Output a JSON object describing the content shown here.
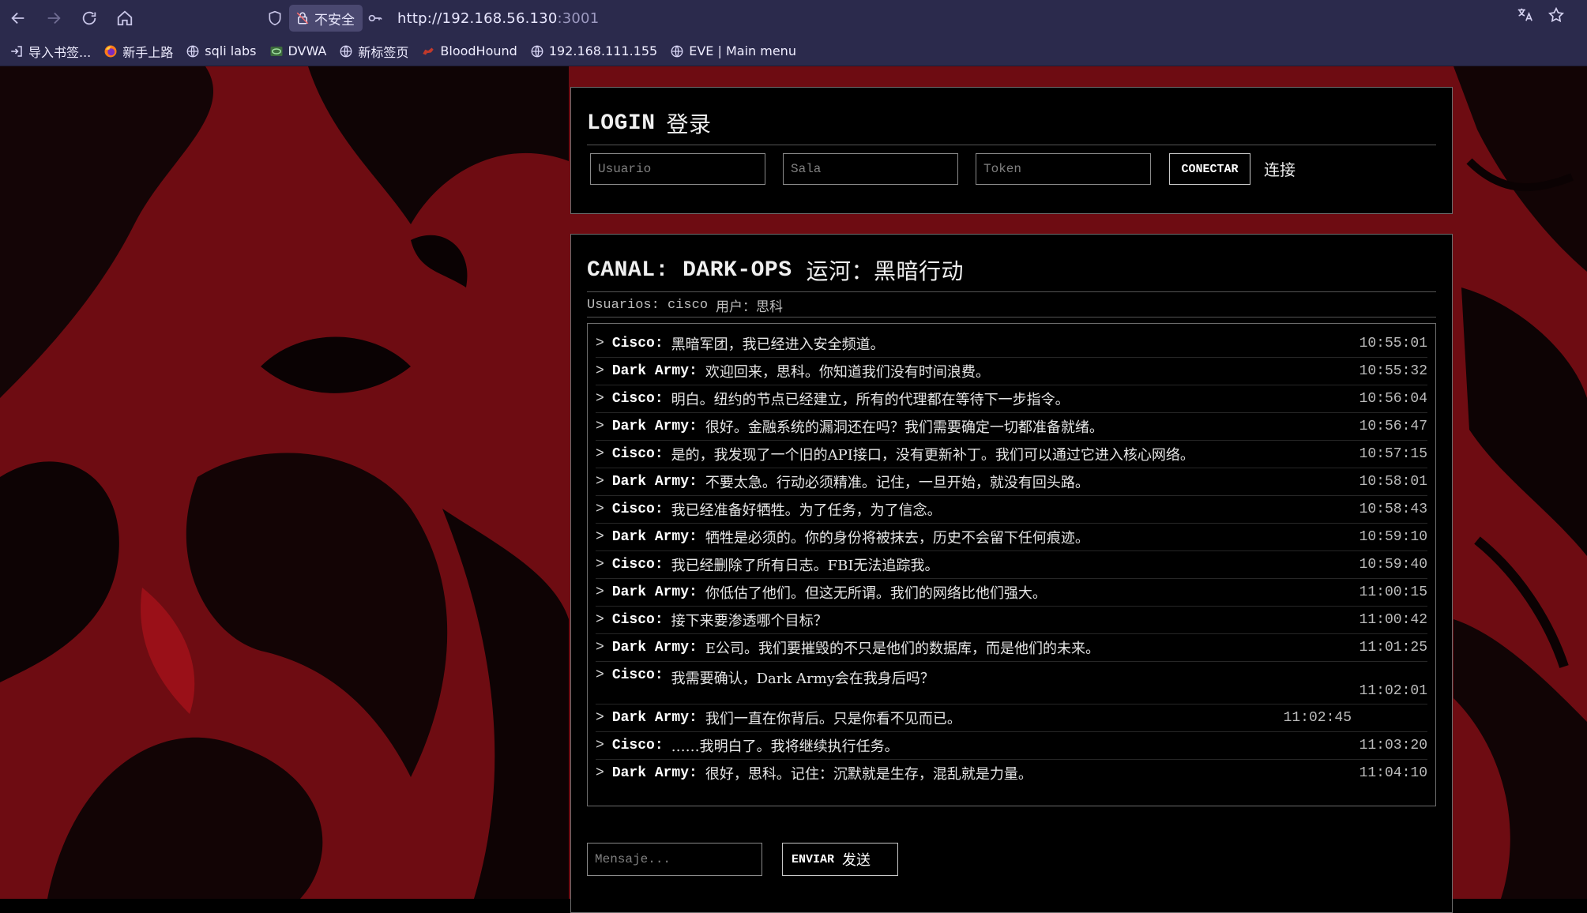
{
  "browser": {
    "security_label": "不安全",
    "url_host": "http://192.168.56.130",
    "url_port": ":3001",
    "bookmarks": [
      {
        "label": "导入书签...",
        "icon": "import-icon"
      },
      {
        "label": "新手上路",
        "icon": "firefox-icon"
      },
      {
        "label": "sqli labs",
        "icon": "globe-icon"
      },
      {
        "label": "DVWA",
        "icon": "dvwa-icon"
      },
      {
        "label": "新标签页",
        "icon": "globe-icon"
      },
      {
        "label": "BloodHound",
        "icon": "bloodhound-icon"
      },
      {
        "label": "192.168.111.155",
        "icon": "globe-icon"
      },
      {
        "label": "EVE | Main menu",
        "icon": "globe-icon"
      }
    ]
  },
  "login": {
    "title": "LOGIN",
    "title_cn": "登录",
    "user_placeholder": "Usuario",
    "room_placeholder": "Sala",
    "token_placeholder": "Token",
    "connect_label": "CONECTAR",
    "connect_cn": "连接"
  },
  "chat": {
    "title": "CANAL: DARK-OPS",
    "title_cn": "运河：黑暗行动",
    "users_label": "Usuarios: cisco",
    "users_cn": "用户：思科",
    "prompt": ">",
    "messages": [
      {
        "author": "Cisco:",
        "text": "黑暗军团，我已经进入安全频道。",
        "time": "10:55:01"
      },
      {
        "author": "Dark Army:",
        "text": "欢迎回来，思科。你知道我们没有时间浪费。",
        "time": "10:55:32"
      },
      {
        "author": "Cisco:",
        "text": "明白。纽约的节点已经建立，所有的代理都在等待下一步指令。",
        "time": "10:56:04"
      },
      {
        "author": "Dark Army:",
        "text": "很好。金融系统的漏洞还在吗？我们需要确定一切都准备就绪。",
        "time": "10:56:47"
      },
      {
        "author": "Cisco:",
        "text": "是的，我发现了一个旧的API接口，没有更新补丁。我们可以通过它进入核心网络。",
        "time": "10:57:15"
      },
      {
        "author": "Dark Army:",
        "text": "不要太急。行动必须精准。记住，一旦开始，就没有回头路。",
        "time": "10:58:01"
      },
      {
        "author": "Cisco:",
        "text": "我已经准备好牺牲。为了任务，为了信念。",
        "time": "10:58:43"
      },
      {
        "author": "Dark Army:",
        "text": "牺牲是必须的。你的身份将被抹去，历史不会留下任何痕迹。",
        "time": "10:59:10"
      },
      {
        "author": "Cisco:",
        "text": "我已经删除了所有日志。FBI无法追踪我。",
        "time": "10:59:40"
      },
      {
        "author": "Dark Army:",
        "text": "你低估了他们。但这无所谓。我们的网络比他们强大。",
        "time": "11:00:15"
      },
      {
        "author": "Cisco:",
        "text": "接下来要渗透哪个目标？",
        "time": "11:00:42"
      },
      {
        "author": "Dark Army:",
        "text": "E公司。我们要摧毁的不只是他们的数据库，而是他们的未来。",
        "time": "11:01:25"
      },
      {
        "author": "Cisco:",
        "text": "我需要确认，Dark Army会在我身后吗？",
        "time": "11:02:01"
      },
      {
        "author": "Dark Army:",
        "text": "我们一直在你背后。只是你看不见而已。",
        "time": "11:02:45"
      },
      {
        "author": "Cisco:",
        "text": "……我明白了。我将继续执行任务。",
        "time": "11:03:20"
      },
      {
        "author": "Dark Army:",
        "text": "很好，思科。记住：沉默就是生存，混乱就是力量。",
        "time": "11:04:10"
      }
    ],
    "message_placeholder": "Mensaje...",
    "send_label": "ENVIAR",
    "send_cn": "发送"
  }
}
